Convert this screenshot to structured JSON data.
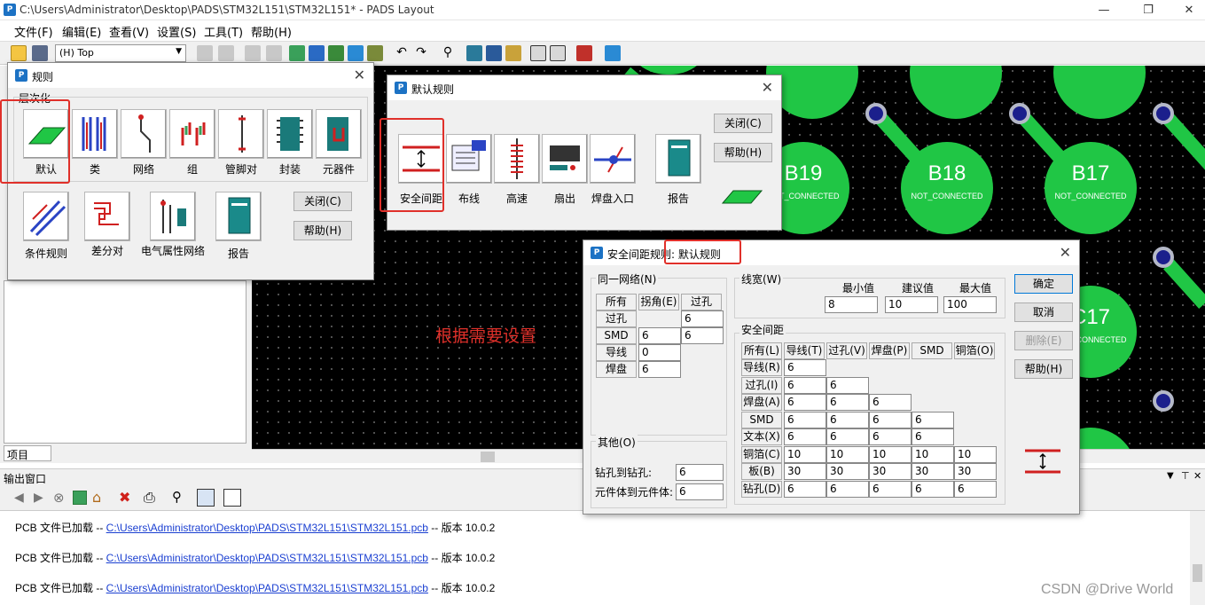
{
  "window": {
    "title": "C:\\Users\\Administrator\\Desktop\\PADS\\STM32L151\\STM32L151* - PADS Layout"
  },
  "menu": [
    "文件(F)",
    "编辑(E)",
    "查看(V)",
    "设置(S)",
    "工具(T)",
    "帮助(H)"
  ],
  "toolbar": {
    "layer": "(H) Top"
  },
  "canvas": {
    "note": "根据需要设置",
    "pads": [
      {
        "name": "B19",
        "net": "NOT_CONNECTED"
      },
      {
        "name": "B18",
        "net": "NOT_CONNECTED"
      },
      {
        "name": "B17",
        "net": "NOT_CONNECTED"
      },
      {
        "name": "C17",
        "net": "NOT_CONNECTED"
      }
    ]
  },
  "left_pane": {
    "tab": "项目"
  },
  "output": {
    "title": "输出窗口",
    "lines": [
      {
        "prefix": "PCB 文件已加载  -- ",
        "link": "C:\\Users\\Administrator\\Desktop\\PADS\\STM32L151\\STM32L151.pcb",
        "suffix": "  -- 版本  10.0.2"
      },
      {
        "prefix": "PCB 文件已加载  -- ",
        "link": "C:\\Users\\Administrator\\Desktop\\PADS\\STM32L151\\STM32L151.pcb",
        "suffix": "  -- 版本  10.0.2"
      },
      {
        "prefix": "PCB 文件已加载  -- ",
        "link": "C:\\Users\\Administrator\\Desktop\\PADS\\STM32L151\\STM32L151.pcb",
        "suffix": "  -- 版本  10.0.2"
      }
    ]
  },
  "rules_dialog": {
    "title": "规则",
    "section": "层次化",
    "items": [
      "默认",
      "类",
      "网络",
      "组",
      "管脚对",
      "封装",
      "元器件",
      "条件规则",
      "差分对",
      "电气属性网络",
      "报告"
    ],
    "close": "关闭(C)",
    "help": "帮助(H)"
  },
  "default_rules_dialog": {
    "title": "默认规则",
    "items": [
      "安全间距",
      "布线",
      "高速",
      "扇出",
      "焊盘入口",
      "报告"
    ],
    "close": "关闭(C)",
    "help": "帮助(H)"
  },
  "clearance_dialog": {
    "title_prefix": "安全间距规则: ",
    "title_highlight": "默认规则",
    "same_net": {
      "label": "同一网络(N)",
      "headers": [
        "所有",
        "拐角(E)",
        "过孔"
      ],
      "rows": [
        {
          "label": "过孔",
          "values": [
            "",
            "6"
          ]
        },
        {
          "label": "SMD",
          "values": [
            "6",
            "6"
          ]
        },
        {
          "label": "导线",
          "values": [
            "0"
          ]
        },
        {
          "label": "焊盘",
          "values": [
            "6"
          ]
        }
      ]
    },
    "trace_width": {
      "label": "线宽(W)",
      "headers": [
        "最小值",
        "建议值",
        "最大值"
      ],
      "values": [
        "8",
        "10",
        "100"
      ]
    },
    "clearance": {
      "label": "安全间距",
      "headers": [
        "所有(L)",
        "导线(T)",
        "过孔(V)",
        "焊盘(P)",
        "SMD",
        "铜箔(O)"
      ],
      "rows": [
        {
          "label": "导线(R)",
          "values": [
            "6"
          ]
        },
        {
          "label": "过孔(I)",
          "values": [
            "6",
            "6"
          ]
        },
        {
          "label": "焊盘(A)",
          "values": [
            "6",
            "6",
            "6"
          ]
        },
        {
          "label": "SMD",
          "values": [
            "6",
            "6",
            "6",
            "6"
          ]
        },
        {
          "label": "文本(X)",
          "values": [
            "6",
            "6",
            "6",
            "6"
          ]
        },
        {
          "label": "铜箔(C)",
          "values": [
            "10",
            "10",
            "10",
            "10",
            "10"
          ]
        },
        {
          "label": "板(B)",
          "values": [
            "30",
            "30",
            "30",
            "30",
            "30"
          ]
        },
        {
          "label": "钻孔(D)",
          "values": [
            "6",
            "6",
            "6",
            "6",
            "6"
          ]
        }
      ]
    },
    "other": {
      "label": "其他(O)",
      "drill_to_drill_label": "钻孔到钻孔:",
      "drill_to_drill": "6",
      "body_to_body_label": "元件体到元件体:",
      "body_to_body": "6"
    },
    "buttons": {
      "ok": "确定",
      "cancel": "取消",
      "delete": "删除(E)",
      "help": "帮助(H)"
    }
  },
  "watermark": "CSDN @Drive World"
}
